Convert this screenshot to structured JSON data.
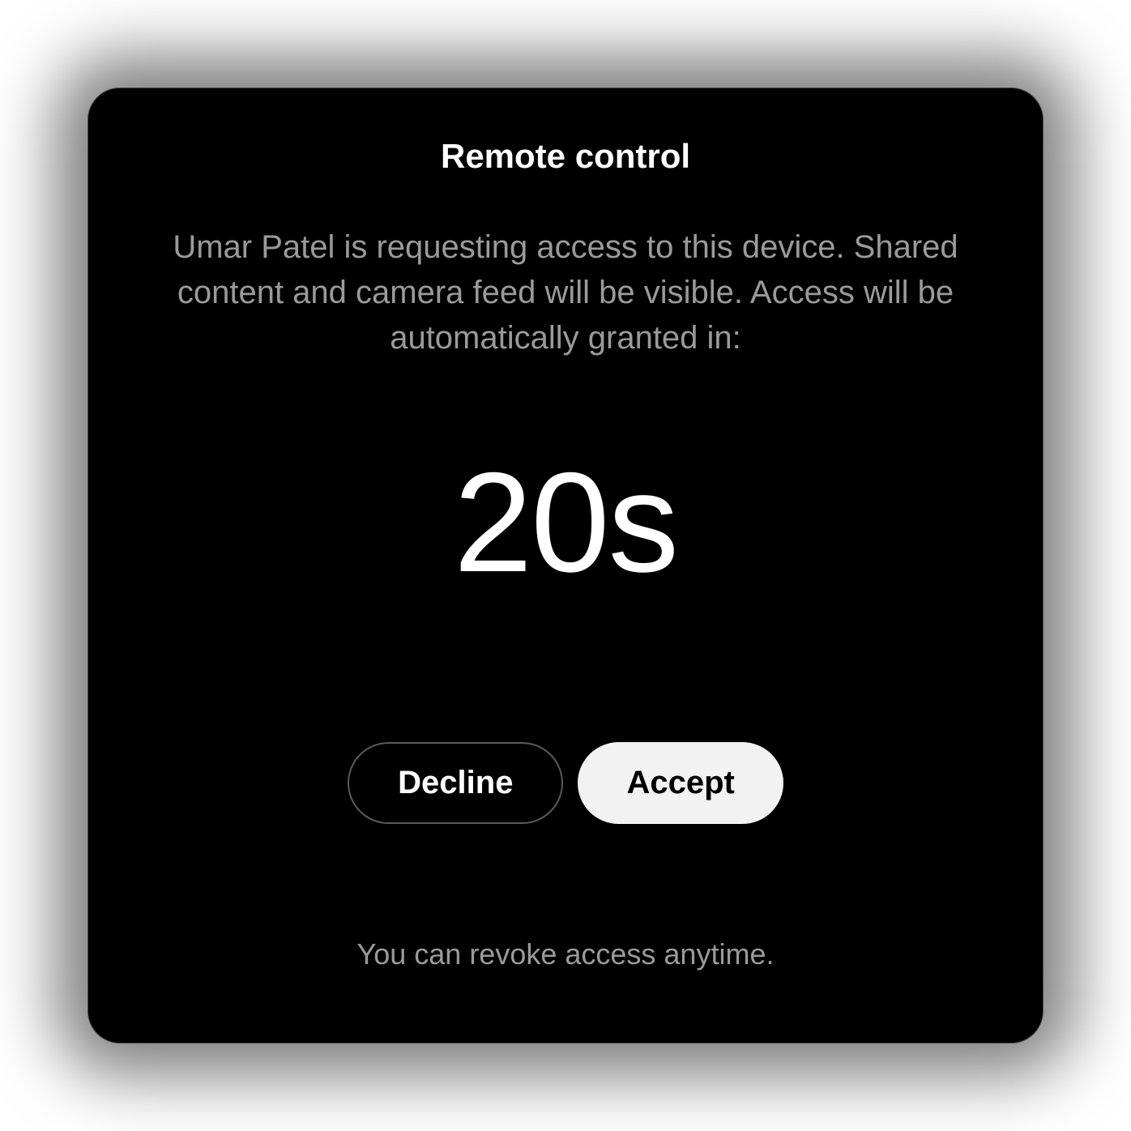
{
  "dialog": {
    "title": "Remote control",
    "description": "Umar Patel is requesting access to this device. Shared content and camera feed will be visible. Access will be automatically granted in:",
    "countdown": "20s",
    "buttons": {
      "decline": "Decline",
      "accept": "Accept"
    },
    "footer": "You can revoke access anytime."
  }
}
